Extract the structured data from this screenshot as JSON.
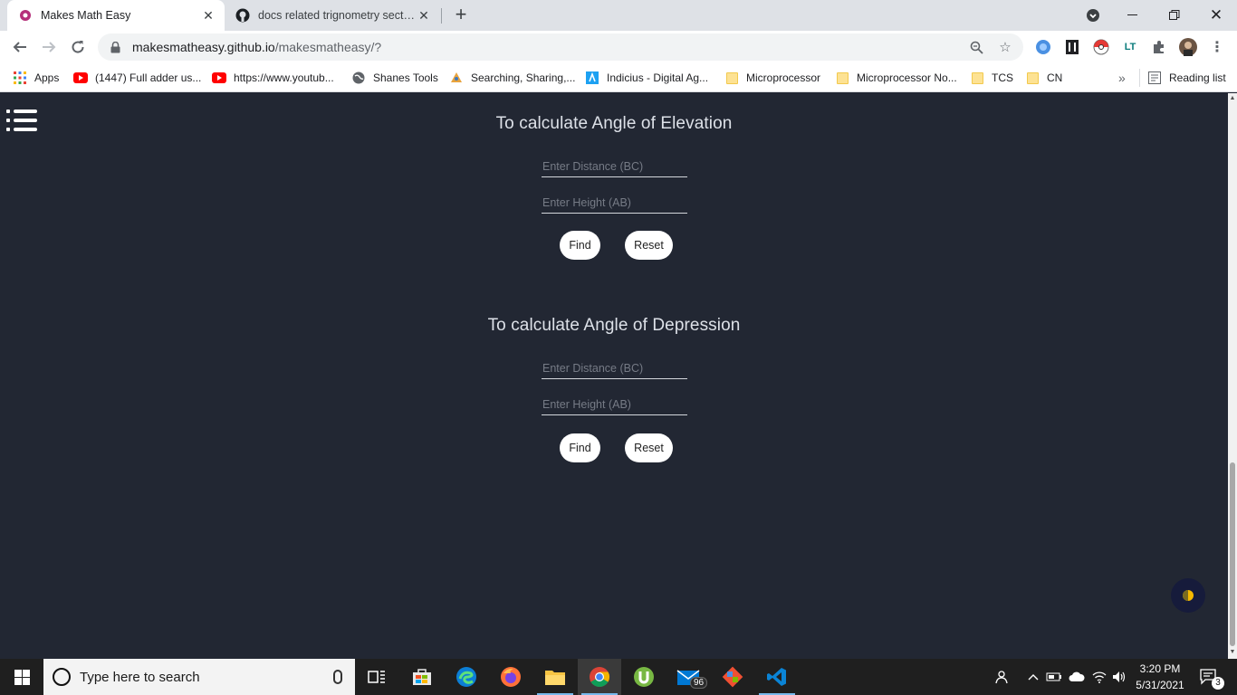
{
  "browser": {
    "tabs": [
      {
        "title": "Makes Math Easy",
        "active": true
      },
      {
        "title": "docs related trignometry section",
        "active": false
      }
    ],
    "url_domain": "makesmatheasy.github.io",
    "url_path": "/makesmatheasy/?"
  },
  "bookmarks": {
    "items": [
      {
        "label": "Apps",
        "icon": "apps-grid-icon"
      },
      {
        "label": "(1447) Full adder us...",
        "icon": "youtube-icon"
      },
      {
        "label": "https://www.youtub...",
        "icon": "youtube-icon"
      },
      {
        "label": "Shanes Tools",
        "icon": "globe-icon"
      },
      {
        "label": "Searching, Sharing,...",
        "icon": "site-icon"
      },
      {
        "label": "Indicius - Digital Ag...",
        "icon": "site-icon"
      },
      {
        "label": "Microprocessor",
        "icon": "folder-icon"
      },
      {
        "label": "Microprocessor No...",
        "icon": "folder-icon"
      },
      {
        "label": "TCS",
        "icon": "folder-icon"
      },
      {
        "label": "CN",
        "icon": "folder-icon"
      }
    ],
    "overflow": "»",
    "reading_list": "Reading list"
  },
  "page": {
    "elevation": {
      "title": "To calculate Angle of Elevation",
      "distance_placeholder": "Enter Distance (BC)",
      "height_placeholder": "Enter Height (AB)",
      "find_label": "Find",
      "reset_label": "Reset"
    },
    "depression": {
      "title": "To calculate Angle of Depression",
      "distance_placeholder": "Enter Distance (BC)",
      "height_placeholder": "Enter Height (AB)",
      "find_label": "Find",
      "reset_label": "Reset"
    }
  },
  "taskbar": {
    "search_placeholder": "Type here to search",
    "mail_badge": "96",
    "time": "3:20 PM",
    "date": "5/31/2021",
    "notification_count": "3"
  },
  "colors": {
    "page_bg": "#222733",
    "heading": "#dde1e8",
    "button_bg": "#ffffff"
  }
}
